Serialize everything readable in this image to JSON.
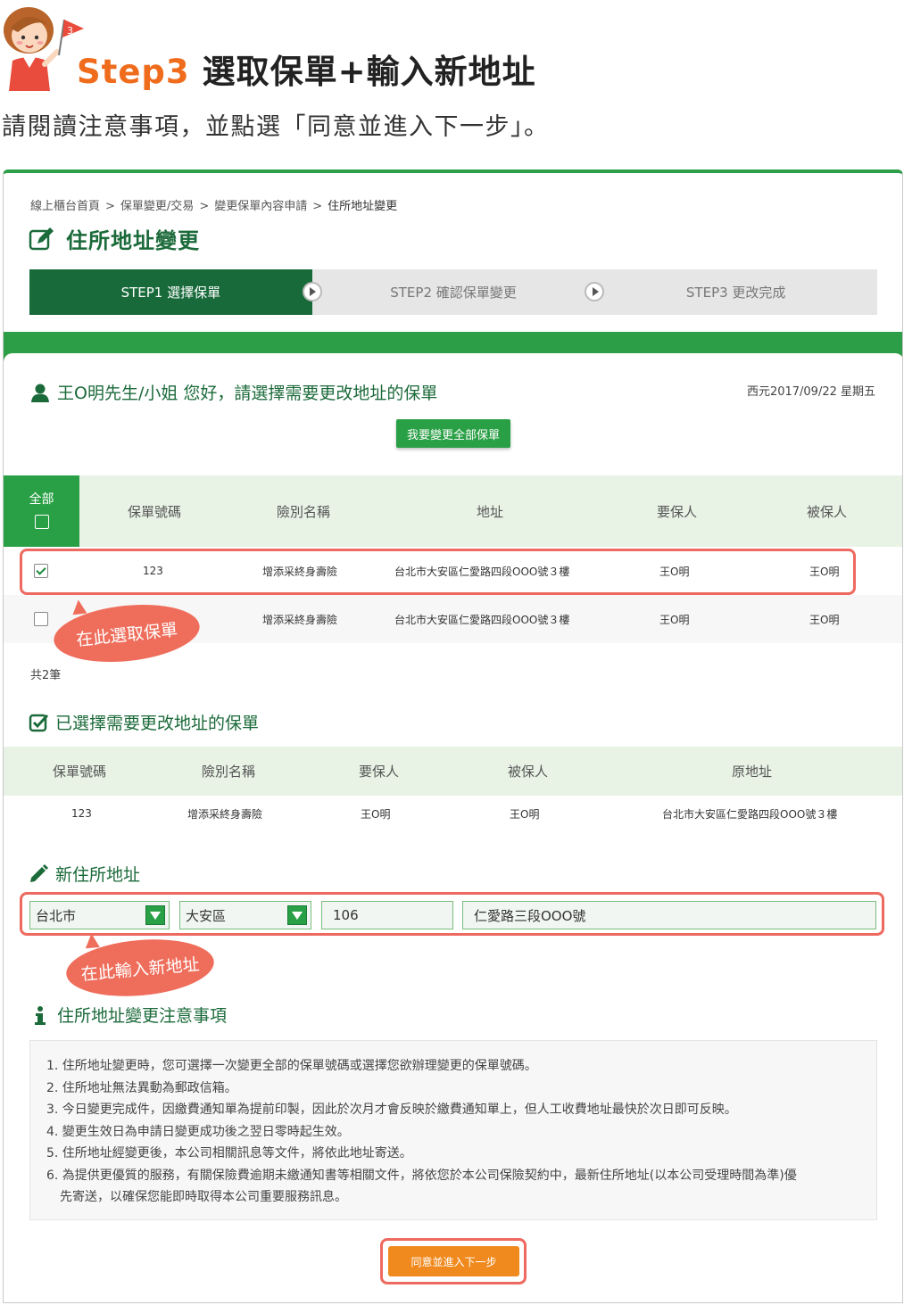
{
  "tutorial": {
    "step_label": "Step3",
    "title": "選取保單+輸入新地址",
    "description": "請閱讀注意事項，並點選「同意並進入下一步」。",
    "mascot_flag": "3"
  },
  "breadcrumb": [
    "線上櫃台首頁",
    "保單變更/交易",
    "變更保單內容申請",
    "住所地址變更"
  ],
  "breadcrumb_sep": ">",
  "page_title": "住所地址變更",
  "stepper": [
    {
      "label": "STEP1 選擇保單",
      "active": true
    },
    {
      "label": "STEP2 確認保單變更",
      "active": false
    },
    {
      "label": "STEP3 更改完成",
      "active": false
    }
  ],
  "greeting": "王O明先生/小姐 您好，請選擇需要更改地址的保單",
  "date": "西元2017/09/22 星期五",
  "change_all_button": "我要變更全部保單",
  "policy_table": {
    "select_all_label": "全部",
    "headers": [
      "保單號碼",
      "險別名稱",
      "地址",
      "要保人",
      "被保人"
    ],
    "rows": [
      {
        "checked": true,
        "policy_no": "123",
        "product": "增添采終身壽險",
        "address": "台北市大安區仁愛路四段OOO號３樓",
        "applicant": "王O明",
        "insured": "王O明"
      },
      {
        "checked": false,
        "policy_no": "",
        "product": "增添采終身壽險",
        "address": "台北市大安區仁愛路四段OOO號３樓",
        "applicant": "王O明",
        "insured": "王O明"
      }
    ],
    "count": "共2筆"
  },
  "callouts": {
    "select_policy": "在此選取保單",
    "enter_address": "在此輸入新地址"
  },
  "selected_section": {
    "title": "已選擇需要更改地址的保單",
    "headers": [
      "保單號碼",
      "險別名稱",
      "要保人",
      "被保人",
      "原地址"
    ],
    "row": {
      "policy_no": "123",
      "product": "增添采終身壽險",
      "applicant": "王O明",
      "insured": "王O明",
      "old_address": "台北市大安區仁愛路四段OOO號３樓"
    }
  },
  "new_address": {
    "title": "新住所地址",
    "city": "台北市",
    "district": "大安區",
    "zip": "106",
    "street": "仁愛路三段OOO號"
  },
  "notes": {
    "title": "住所地址變更注意事項",
    "lines": [
      "1. 住所地址變更時，您可選擇一次變更全部的保單號碼或選擇您欲辦理變更的保單號碼。",
      "2. 住所地址無法異動為郵政信箱。",
      "3. 今日變更完成件，因繳費通知單為提前印製，因此於次月才會反映於繳費通知單上，但人工收費地址最快於次日即可反映。",
      "4. 變更生效日為申請日變更成功後之翌日零時起生效。",
      "5. 住所地址經變更後，本公司相關訊息等文件，將依此地址寄送。",
      "6. 為提供更優質的服務，有關保險費逾期未繳通知書等相關文件，將依您於本公司保險契約中，最新住所地址(以本公司受理時間為準)優",
      "先寄送，以確保您能即時取得本公司重要服務訊息。"
    ]
  },
  "next_button": "同意並進入下一步",
  "colors": {
    "brand_green": "#2aa046",
    "dark_green": "#186a3b",
    "highlight_red": "#ee6a60",
    "orange": "#f08a1e",
    "step_orange": "#ef6c1c"
  }
}
